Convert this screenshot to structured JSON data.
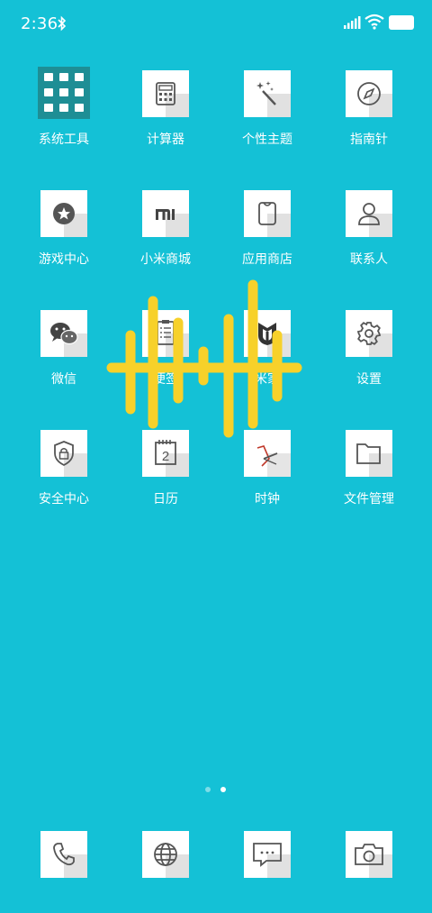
{
  "status": {
    "time": "2:36"
  },
  "grid": [
    {
      "label": "系统工具"
    },
    {
      "label": "计算器"
    },
    {
      "label": "个性主题"
    },
    {
      "label": "指南针"
    },
    {
      "label": "游戏中心"
    },
    {
      "label": "小米商城"
    },
    {
      "label": "应用商店"
    },
    {
      "label": "联系人"
    },
    {
      "label": "微信"
    },
    {
      "label": "便签"
    },
    {
      "label": "米家"
    },
    {
      "label": "设置"
    },
    {
      "label": "安全中心"
    },
    {
      "label": "日历"
    },
    {
      "label": "时钟"
    },
    {
      "label": "文件管理"
    }
  ],
  "calendar_day": "2",
  "page_indicator": {
    "pages": 2,
    "current": 2
  },
  "colors": {
    "background": "#14C1D6",
    "voice_overlay": "#F7D12A",
    "icon_gray": "#555555"
  },
  "dock": [
    {
      "icon": "phone-icon"
    },
    {
      "icon": "browser-icon"
    },
    {
      "icon": "messages-icon"
    },
    {
      "icon": "camera-icon"
    }
  ]
}
